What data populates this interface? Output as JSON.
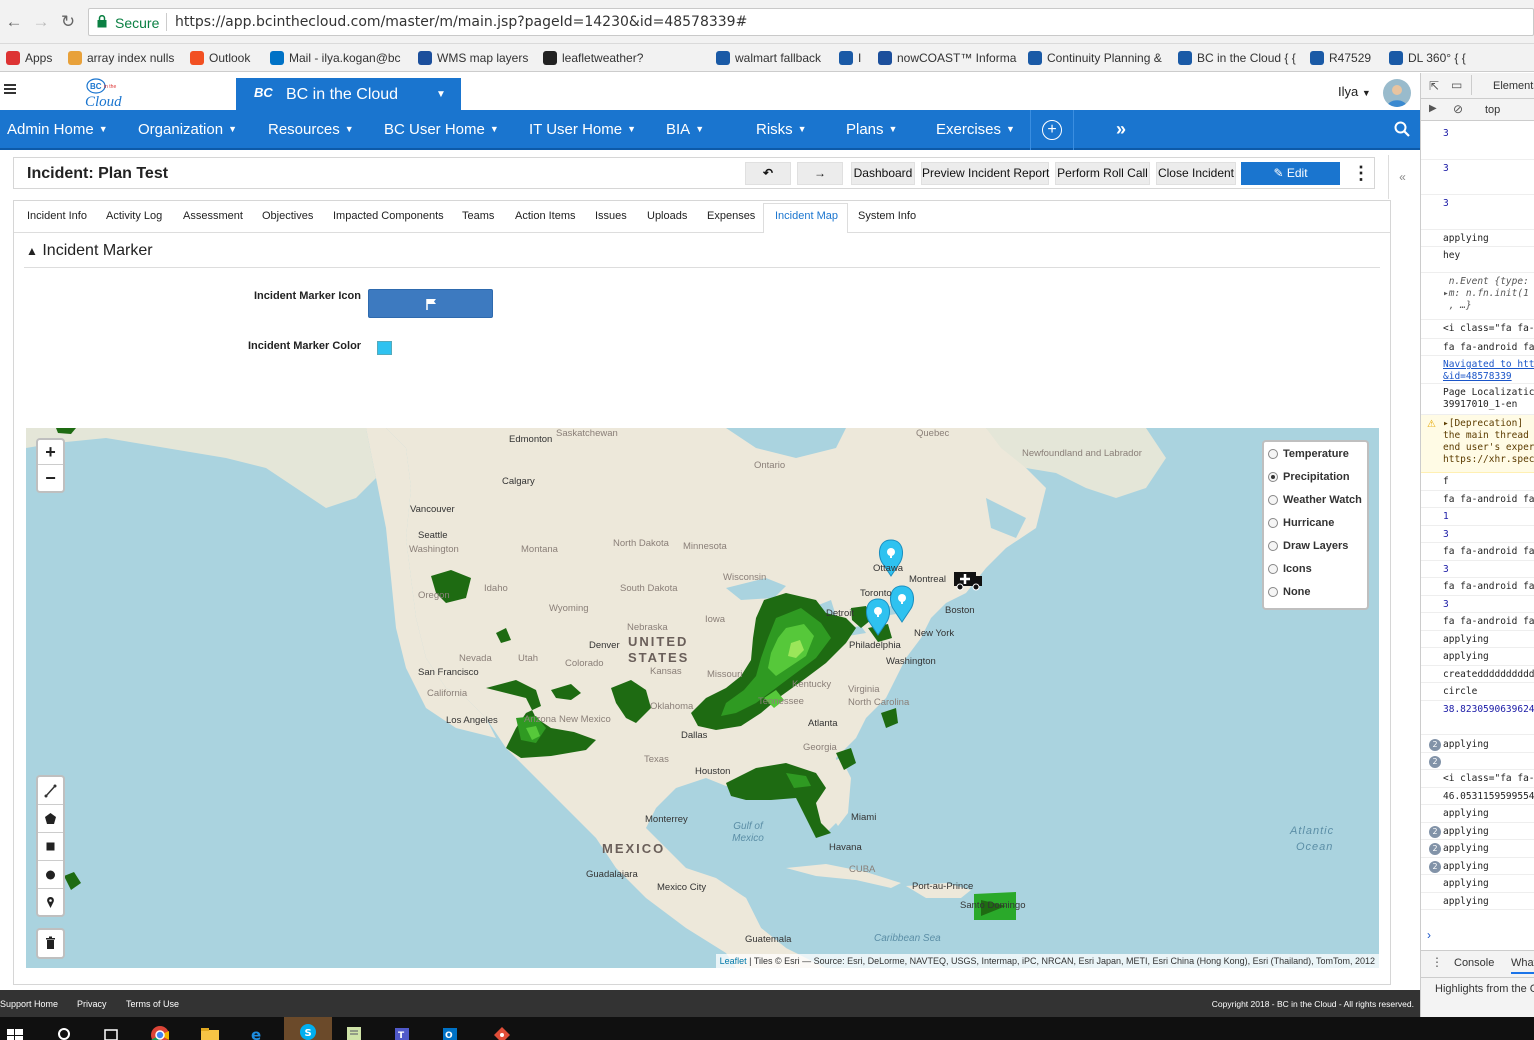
{
  "browser": {
    "secure_label": "Secure",
    "url": "https://app.bcinthecloud.com/master/m/main.jsp?pageId=14230&id=48578339#",
    "bookmarks": [
      {
        "label": "Apps",
        "color": "#d33"
      },
      {
        "label": "array index nulls",
        "color": "#e8a13a"
      },
      {
        "label": "Outlook",
        "color": "#f25022"
      },
      {
        "label": "Mail - ilya.kogan@bc",
        "color": "#0072c6"
      },
      {
        "label": "WMS map layers",
        "color": "#1c4f9c"
      },
      {
        "label": "leafletweather?",
        "color": "#222"
      },
      {
        "label": "walmart fallback",
        "color": "#1a5aa6"
      },
      {
        "label": "I",
        "color": "#1a5aa6"
      },
      {
        "label": "nowCOAST™ Informa",
        "color": "#1c4f9c"
      },
      {
        "label": "Continuity Planning &",
        "color": "#1a5aa6"
      },
      {
        "label": "BC in the Cloud { {",
        "color": "#1a5aa6"
      },
      {
        "label": "R47529",
        "color": "#1a5aa6"
      },
      {
        "label": "DL 360° { {",
        "color": "#1a5aa6"
      }
    ]
  },
  "app": {
    "tab_title": "BC in the Cloud",
    "tab_logo": "BC",
    "user": "Ilya",
    "nav": [
      "Admin Home",
      "Organization",
      "Resources",
      "BC User Home",
      "IT User Home",
      "BIA",
      "Risks",
      "Plans",
      "Exercises"
    ]
  },
  "page": {
    "title": "Incident: Plan Test",
    "buttons": {
      "dashboard": "Dashboard",
      "preview": "Preview Incident Report",
      "rollcall": "Perform Roll Call",
      "close": "Close Incident",
      "edit": "Edit"
    },
    "tabs": [
      "Incident Info",
      "Activity Log",
      "Assessment",
      "Objectives",
      "Impacted Components",
      "Teams",
      "Action Items",
      "Issues",
      "Uploads",
      "Expenses",
      "Incident Map",
      "System Info"
    ],
    "active_tab": "Incident Map",
    "section_title": "Incident Marker",
    "marker_icon_label": "Incident Marker Icon",
    "marker_icon": "flag-icon",
    "marker_color_label": "Incident Marker Color",
    "marker_color": "#2fc2f0"
  },
  "map": {
    "layers": [
      {
        "label": "Temperature",
        "selected": false
      },
      {
        "label": "Precipitation",
        "selected": true
      },
      {
        "label": "Weather Watch",
        "selected": false
      },
      {
        "label": "Hurricane",
        "selected": false
      },
      {
        "label": "Draw Layers",
        "selected": false
      },
      {
        "label": "Icons",
        "selected": false
      },
      {
        "label": "None",
        "selected": false
      }
    ],
    "attribution_link": "Leaflet",
    "attribution_text": "| Tiles © Esri — Source: Esri, DeLorme, NAVTEQ, USGS, Intermap, iPC, NRCAN, Esri Japan, METI, Esri China (Hong Kong), Esri (Thailand), TomTom, 2012",
    "labels": {
      "edmonton": "Edmonton",
      "calgary": "Calgary",
      "vancouver": "Vancouver",
      "seattle": "Seattle",
      "washington_state": "Washington",
      "montana": "Montana",
      "north_dakota": "North Dakota",
      "minnesota": "Minnesota",
      "south_dakota": "South Dakota",
      "wisconsin": "Wisconsin",
      "wyoming": "Wyoming",
      "idaho": "Idaho",
      "oregon": "Oregon",
      "nebraska": "Nebraska",
      "iowa": "Iowa",
      "united": "UNITED",
      "states": "STATES",
      "denver": "Denver",
      "nevada": "Nevada",
      "utah": "Utah",
      "colorado": "Colorado",
      "kansas": "Kansas",
      "san_francisco": "San Francisco",
      "california": "California",
      "los_angeles": "Los Angeles",
      "new_mexico": "New Mexico",
      "arizona": "Arizona",
      "oklahoma": "Oklahoma",
      "dallas": "Dallas",
      "texas": "Texas",
      "houston": "Houston",
      "missouri": "Missouri",
      "detroit": "Detroit",
      "toronto": "Toronto",
      "montreal": "Montreal",
      "ottawa": "Ottawa",
      "boston": "Boston",
      "new_york": "New York",
      "philadelphia": "Philadelphia",
      "washington": "Washington",
      "virginia": "Virginia",
      "north_carolina": "North Carolina",
      "atlanta": "Atlanta",
      "georgia": "Georgia",
      "kentucky": "Kentucky",
      "tennessee": "Tennessee",
      "miami": "Miami",
      "monterrey": "Monterrey",
      "mexico": "MEXICO",
      "guadalajara": "Guadalajara",
      "mexico_city": "Mexico City",
      "havana": "Havana",
      "cuba": "CUBA",
      "port_au_prince": "Port-au-Prince",
      "santo_domingo": "Santo Domingo",
      "guatemala": "Guatemala",
      "caribbean_sea": "Caribbean Sea",
      "gulf_of_mexico": "Gulf of Mexico",
      "atlantic": "Atlantic",
      "ocean": "Ocean",
      "ontario": "Ontario",
      "quebec": "Quebec",
      "newfoundland": "Newfoundland and Labrador",
      "saskatchewan": "Saskatchewan"
    }
  },
  "footer": {
    "support": "Support Home",
    "privacy": "Privacy",
    "terms": "Terms of Use",
    "copyright": "Copyright 2018 - BC in the Cloud - All rights reserved."
  },
  "devtools": {
    "tab": "Elements",
    "context": "top",
    "console_tab": "Console",
    "whats_new_tab": "What",
    "highlights": "Highlights from the C",
    "lines": [
      {
        "text": "3",
        "style": "blue"
      },
      {
        "text": "3",
        "style": "blue"
      },
      {
        "text": "3",
        "style": "blue"
      },
      {
        "text": "applying",
        "style": ""
      },
      {
        "text": "hey",
        "style": ""
      },
      {
        "text": " n.Event {type:\n▸m: n.fn.init(1\n , …}",
        "style": "gray"
      },
      {
        "text": "<i class=\"fa fa-",
        "style": ""
      },
      {
        "text": "fa fa-android fa",
        "style": ""
      },
      {
        "text": "Navigated to htt\n&id=48578339",
        "style": "link"
      },
      {
        "text": "Page Localizatic\n39917010_1-en",
        "style": ""
      },
      {
        "text": "▸[Deprecation]\nthe main thread\nend user's exper\nhttps://xhr.spec",
        "style": "warn"
      },
      {
        "text": "f",
        "style": ""
      },
      {
        "text": "fa fa-android fa",
        "style": ""
      },
      {
        "text": "1",
        "style": "blue"
      },
      {
        "text": "3",
        "style": "blue"
      },
      {
        "text": "fa fa-android fa",
        "style": ""
      },
      {
        "text": "3",
        "style": "blue"
      },
      {
        "text": "fa fa-android fa",
        "style": ""
      },
      {
        "text": "3",
        "style": "blue"
      },
      {
        "text": "fa fa-android fa",
        "style": ""
      },
      {
        "text": "applying",
        "style": ""
      },
      {
        "text": "applying",
        "style": ""
      },
      {
        "text": "createddddddddddd",
        "style": ""
      },
      {
        "text": "circle",
        "style": ""
      },
      {
        "text": "38.82305906396245",
        "style": "blue"
      },
      {
        "text": "applying",
        "style": "",
        "badge": "2"
      },
      {
        "text": "",
        "style": "",
        "badge": "2"
      },
      {
        "text": "<i class=\"fa fa-",
        "style": ""
      },
      {
        "text": "46.05311595995544",
        "style": ""
      },
      {
        "text": "applying",
        "style": ""
      },
      {
        "text": "applying",
        "style": "",
        "badge": "2"
      },
      {
        "text": "applying",
        "style": "",
        "badge": "2"
      },
      {
        "text": "applying",
        "style": "",
        "badge": "2"
      },
      {
        "text": "applying",
        "style": ""
      },
      {
        "text": "applying",
        "style": ""
      }
    ]
  }
}
